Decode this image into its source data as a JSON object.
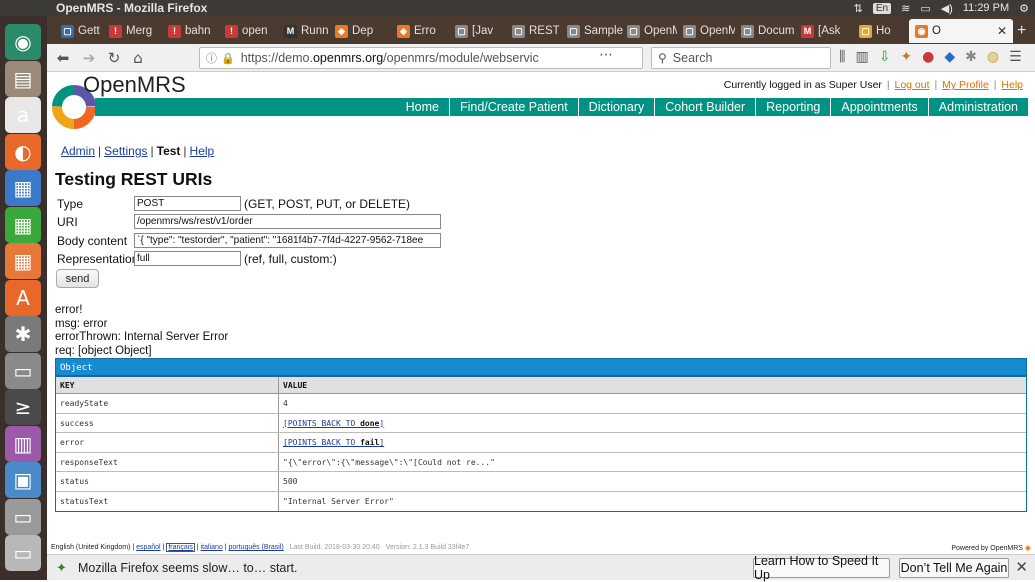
{
  "os": {
    "title": "OpenMRS - Mozilla Firefox",
    "kb": "En",
    "time": "11:29 PM"
  },
  "launcher": {
    "items": [
      {
        "name": "ubuntu-icon",
        "glyph": "◉",
        "color": "#2a8a6a"
      },
      {
        "name": "files-icon",
        "glyph": "▤",
        "color": "#9a8a7a"
      },
      {
        "name": "amazon-icon",
        "glyph": "a",
        "color": "#e8e8e8"
      },
      {
        "name": "firefox-icon",
        "glyph": "◐",
        "color": "#e86a2a"
      },
      {
        "name": "writer-icon",
        "glyph": "▦",
        "color": "#3a7ac8"
      },
      {
        "name": "calc-icon",
        "glyph": "▦",
        "color": "#3aa83a"
      },
      {
        "name": "impress-icon",
        "glyph": "▦",
        "color": "#e8783a"
      },
      {
        "name": "software-icon",
        "glyph": "A",
        "color": "#e8682a"
      },
      {
        "name": "settings-icon",
        "glyph": "✱",
        "color": "#7a7a7a"
      },
      {
        "name": "workspace-icon",
        "glyph": "▭",
        "color": "#8a8a8a"
      },
      {
        "name": "terminal-icon",
        "glyph": "≥",
        "color": "#4a4a4a"
      },
      {
        "name": "switcher-icon",
        "glyph": "▥",
        "color": "#9a5aa8"
      },
      {
        "name": "workbench-icon",
        "glyph": "▣",
        "color": "#4a8ac8"
      },
      {
        "name": "drive-icon",
        "glyph": "▭",
        "color": "#9a9a9a"
      },
      {
        "name": "trash-icon",
        "glyph": "▭",
        "color": "#b8b8b8"
      }
    ]
  },
  "tabs": [
    {
      "label": "Gett",
      "icon_color": "#3a6aa8",
      "glyph": "▢"
    },
    {
      "label": "Merg",
      "icon_color": "#c83a3a",
      "glyph": "!"
    },
    {
      "label": "bahn",
      "icon_color": "#c83a3a",
      "glyph": "!"
    },
    {
      "label": "open",
      "icon_color": "#c83a3a",
      "glyph": "!"
    },
    {
      "label": "Runn",
      "icon_color": "#333333",
      "glyph": "M"
    },
    {
      "label": "Dep",
      "icon_color": "#e8782a",
      "glyph": "◆"
    },
    {
      "label": "Erro",
      "icon_color": "#e8782a",
      "glyph": "◆"
    },
    {
      "label": "[Jav",
      "icon_color": "#888888",
      "glyph": "▢"
    },
    {
      "label": "REST",
      "icon_color": "#888888",
      "glyph": "▢"
    },
    {
      "label": "Sample",
      "icon_color": "#888888",
      "glyph": "▢"
    },
    {
      "label": "OpenM",
      "icon_color": "#888888",
      "glyph": "▢"
    },
    {
      "label": "OpenM",
      "icon_color": "#888888",
      "glyph": "▢"
    },
    {
      "label": "Docum",
      "icon_color": "#888888",
      "glyph": "▢"
    },
    {
      "label": "[Ask",
      "icon_color": "#c83a3a",
      "glyph": "M"
    },
    {
      "label": "Ho",
      "icon_color": "#e8a82a",
      "glyph": "▢"
    },
    {
      "label": "O",
      "icon_color": "#e8782a",
      "glyph": "◉"
    }
  ],
  "nav": {
    "url_prefix": "https://demo.",
    "url_host": "openmrs.org",
    "url_rest": "/openmrs/module/webservic",
    "search_placeholder": "Search"
  },
  "page": {
    "logo_text": "OpenMRS",
    "user": {
      "logged_in": "Currently logged in as Super User",
      "logout": "Log out",
      "profile": "My Profile",
      "help": "Help"
    },
    "main_nav": [
      "Home",
      "Find/Create Patient",
      "Dictionary",
      "Cohort Builder",
      "Reporting",
      "Appointments",
      "Administration"
    ],
    "sub_nav": {
      "admin": "Admin",
      "settings": "Settings",
      "test": "Test",
      "help": "Help"
    },
    "heading": "Testing REST URIs",
    "form": {
      "type_label": "Type",
      "type_value": "POST",
      "type_hint": "(GET, POST, PUT, or DELETE)",
      "uri_label": "URI",
      "uri_value": "/openmrs/ws/rest/v1/order",
      "body_label": "Body content",
      "body_value": "`{    \"type\": \"testorder\",    \"patient\": \"1681f4b7-7f4d-4227-9562-718ee",
      "rep_label": "Representation",
      "rep_value": "full",
      "rep_hint": "(ref, full, custom:)",
      "send": "send"
    },
    "error_lines": [
      "error!",
      "msg: error",
      "errorThrown: Internal Server Error",
      "req: [object Object]"
    ],
    "object": {
      "header": "Object",
      "col_key": "KEY",
      "col_value": "VALUE",
      "rows": [
        {
          "key": "readyState",
          "value": "4"
        },
        {
          "key": "success",
          "link_prefix": "[POINTS BACK TO ",
          "link_target": "done",
          "link_suffix": "]"
        },
        {
          "key": "error",
          "link_prefix": "[POINTS BACK TO ",
          "link_target": "fail",
          "link_suffix": "]"
        },
        {
          "key": "responseText",
          "value": "\"{\\\"error\\\":{\\\"message\\\":\\\"[Could not re...\""
        },
        {
          "key": "status",
          "value": "500"
        },
        {
          "key": "statusText",
          "value": "\"Internal Server Error\""
        }
      ]
    },
    "footer": {
      "locale": "English (United Kingdom)",
      "langs": [
        "español",
        "français",
        "italiano",
        "português (Brasil)"
      ],
      "build": "Last Build: 2018-03-30 20:40",
      "version": "Version: 2.1.3 Build 33f4e7",
      "powered": "Powered by OpenMRS"
    }
  },
  "notification": {
    "text": "Mozilla Firefox seems slow… to… start.",
    "btn_learn": "Learn How to Speed It Up",
    "btn_dont": "Don’t Tell Me Again"
  }
}
